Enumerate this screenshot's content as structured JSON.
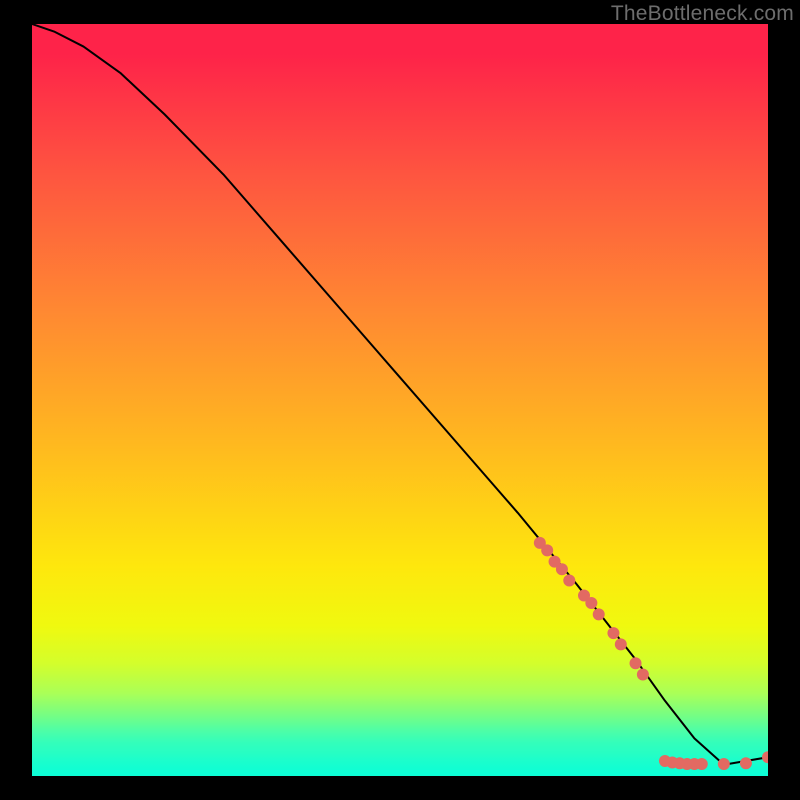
{
  "watermark": "TheBottleneck.com",
  "chart_data": {
    "type": "line",
    "title": "",
    "xlabel": "",
    "ylabel": "",
    "xlim": [
      0,
      100
    ],
    "ylim": [
      0,
      100
    ],
    "grid": false,
    "legend": false,
    "curve": {
      "name": "bottleneck-curve",
      "color": "#000000",
      "x": [
        0,
        3,
        7,
        12,
        18,
        26,
        34,
        42,
        50,
        58,
        66,
        74,
        82,
        86,
        90,
        94,
        100
      ],
      "y": [
        100,
        99,
        97,
        93.5,
        88,
        80,
        71,
        62,
        53,
        44,
        35,
        25.5,
        15.5,
        10,
        5,
        1.5,
        2.5
      ]
    },
    "highlight_points": {
      "name": "highlighted-segment",
      "color": "#e26a62",
      "radius": 6,
      "x": [
        69,
        70,
        71,
        72,
        73,
        75,
        76,
        77,
        79,
        80,
        82,
        83,
        86,
        87,
        88,
        89,
        90,
        91,
        94,
        97,
        100
      ],
      "y": [
        31,
        30,
        28.5,
        27.5,
        26,
        24,
        23,
        21.5,
        19,
        17.5,
        15,
        13.5,
        2,
        1.8,
        1.7,
        1.6,
        1.6,
        1.6,
        1.6,
        1.7,
        2.5
      ]
    }
  }
}
